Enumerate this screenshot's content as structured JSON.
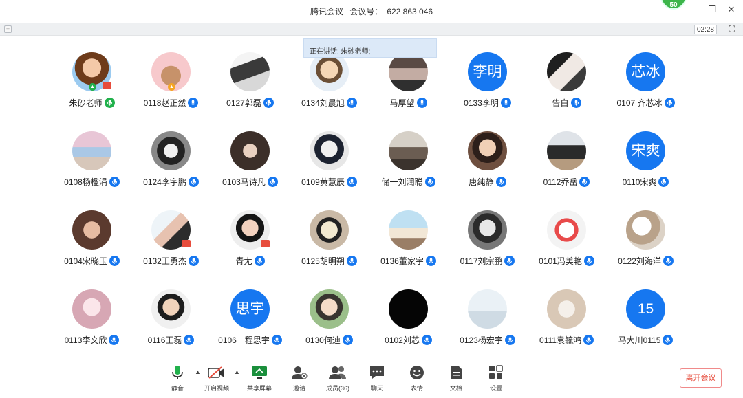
{
  "window": {
    "app": "腾讯会议",
    "meeting_label": "会议号：",
    "meeting_id": "622 863 046",
    "badge": "50",
    "timer": "02:28"
  },
  "speaking": {
    "label": "正在讲话: 朱砂老师;"
  },
  "participants": [
    {
      "name": "朱砂老师",
      "avatar": "photo1",
      "mic": "green",
      "host": true
    },
    {
      "name": "0118赵正然",
      "avatar": "photo2",
      "mic": "blue",
      "cohost": true
    },
    {
      "name": "0127郭磊",
      "avatar": "photo3",
      "mic": "blue"
    },
    {
      "name": "0134刘晨旭",
      "avatar": "photo4",
      "mic": "blue"
    },
    {
      "name": "马厚望",
      "avatar": "photo5",
      "mic": "blue"
    },
    {
      "name": "0133李明",
      "avatar_text": "李明",
      "mic": "blue"
    },
    {
      "name": "告白",
      "avatar": "photo6",
      "mic": "blue"
    },
    {
      "name": "0107 齐芯冰",
      "avatar_text": "芯冰",
      "mic": "blue"
    },
    {
      "name": "0108杨楹涓",
      "avatar": "photo7",
      "mic": "blue"
    },
    {
      "name": "0124李宇鹏",
      "avatar": "photo8",
      "mic": "blue"
    },
    {
      "name": "0103马诗凡",
      "avatar": "photo9",
      "mic": "blue"
    },
    {
      "name": "0109黄慧辰",
      "avatar": "photo10",
      "mic": "blue"
    },
    {
      "name": "储一刘润聪",
      "avatar": "photo11",
      "mic": "blue"
    },
    {
      "name": "唐纯静",
      "avatar": "photo12",
      "mic": "blue"
    },
    {
      "name": "0112乔岳",
      "avatar": "photo13",
      "mic": "blue"
    },
    {
      "name": "0110宋爽",
      "avatar_text": "宋爽",
      "mic": "blue"
    },
    {
      "name": "0104宋晓玉",
      "avatar": "photo14",
      "mic": "blue"
    },
    {
      "name": "0132王勇杰",
      "avatar": "photo15",
      "mic": "blue",
      "share": true
    },
    {
      "name": "青尢",
      "avatar": "photo16",
      "mic": "blue",
      "share": true
    },
    {
      "name": "0125胡明朔",
      "avatar": "photo17",
      "mic": "blue"
    },
    {
      "name": "0136董家宇",
      "avatar": "photo18",
      "mic": "blue"
    },
    {
      "name": "0117刘宗鹏",
      "avatar": "photo19",
      "mic": "blue"
    },
    {
      "name": "0101冯美艳",
      "avatar": "photo20",
      "mic": "blue"
    },
    {
      "name": "0122刘海洋",
      "avatar": "photo21",
      "mic": "blue"
    },
    {
      "name": "0113李文欣",
      "avatar": "photo22",
      "mic": "blue"
    },
    {
      "name": "0116王磊",
      "avatar": "photo23",
      "mic": "blue"
    },
    {
      "name": "0106　程思宇",
      "avatar_text": "思宇",
      "mic": "blue"
    },
    {
      "name": "0130何迪",
      "avatar": "photo24",
      "mic": "blue"
    },
    {
      "name": "0102刘芯",
      "avatar": "photo25",
      "mic": "blue"
    },
    {
      "name": "0123杨宏宇",
      "avatar": "photo26",
      "mic": "blue"
    },
    {
      "name": "0111袁毓鸿",
      "avatar": "photo27",
      "mic": "blue"
    },
    {
      "name": "马大川0115",
      "avatar_text": "15",
      "mic": "blue"
    }
  ],
  "toolbar": {
    "mute": "静音",
    "video": "开启视频",
    "share": "共享屏幕",
    "invite": "邀请",
    "members": "成员(36)",
    "chat": "聊天",
    "reactions": "表情",
    "docs": "文档",
    "settings": "设置",
    "leave": "离开会议"
  },
  "colors": {
    "accent": "#1677f0",
    "mic_green": "#22b14c",
    "leave_red": "#e74c3c"
  }
}
